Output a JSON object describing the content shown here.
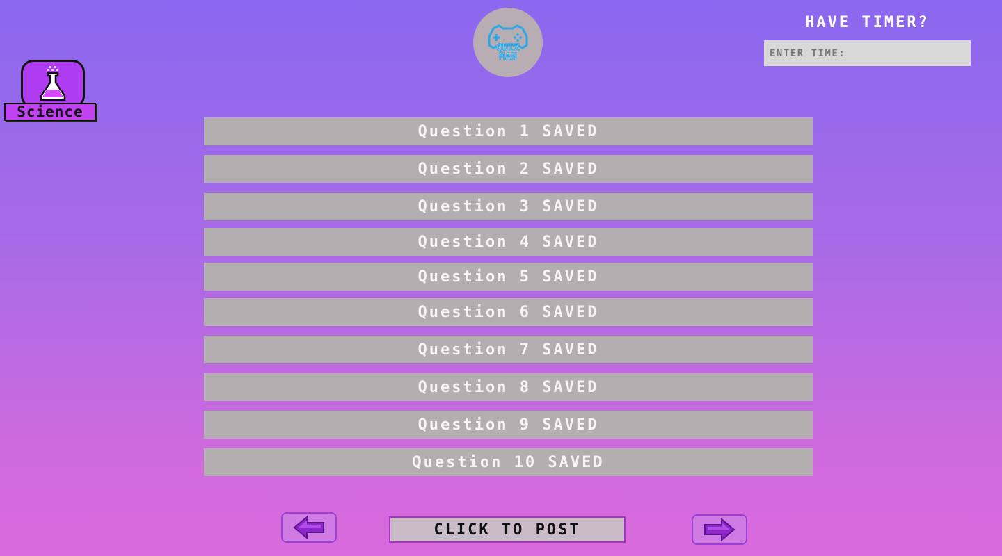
{
  "logo": {
    "text_line1": "QUIZ",
    "text_line2": "MAN",
    "icon": "gamepad-icon"
  },
  "category": {
    "label": "Science",
    "icon": "flask-icon",
    "color": "#b03cf2"
  },
  "timer": {
    "title": "HAVE TIMER?",
    "placeholder": "ENTER TIME:",
    "value": ""
  },
  "questions": [
    {
      "label": "Question 1 SAVED"
    },
    {
      "label": "Question 2 SAVED"
    },
    {
      "label": "Question 3 SAVED"
    },
    {
      "label": "Question 4 SAVED"
    },
    {
      "label": "Question 5 SAVED"
    },
    {
      "label": "Question 6 SAVED"
    },
    {
      "label": "Question 7 SAVED"
    },
    {
      "label": "Question 8 SAVED"
    },
    {
      "label": "Question 9 SAVED"
    },
    {
      "label": "Question 10 SAVED"
    }
  ],
  "controls": {
    "back_icon": "arrow-left-icon",
    "forward_icon": "arrow-right-icon",
    "post_label": "CLICK TO POST"
  }
}
